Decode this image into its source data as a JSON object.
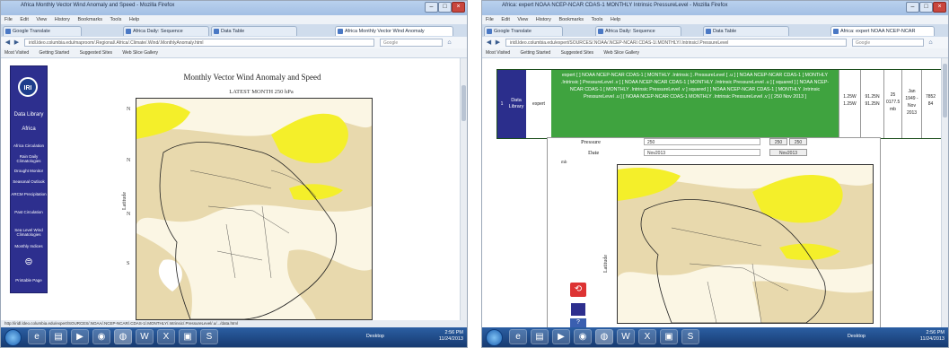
{
  "left_window": {
    "title": "Africa Monthly Vector Wind Anomaly and Speed - Mozilla Firefox",
    "menu": [
      "File",
      "Edit",
      "View",
      "History",
      "Bookmarks",
      "Tools",
      "Help"
    ],
    "tabs": [
      "Google Translate",
      "Africa Daily: Sequence",
      "Data Table",
      "Africa Monthly Vector Wind Anomaly"
    ],
    "url": "iridl.ldeo.columbia.edu/maproom/.Regional/.Africa/.Climate/.Wind/.MonthlyAnomaly.html",
    "search_placeholder": "Google",
    "bookmarks": [
      "Most Visited",
      "Getting Started",
      "Suggested Sites",
      "Web Slice Gallery"
    ],
    "sidebar": {
      "logo": "IRI",
      "items": [
        "Data Library",
        "Africa",
        "Africa Circulation",
        "Rain Daily Climatologies",
        "Drought Monitor",
        "Seasonal Outlook",
        "ARCM Precipitation",
        "Past Circulation",
        "Sea Level Wind Climatologies",
        "Monthly Indices",
        "Expert Mode",
        "Printable Page"
      ]
    },
    "page_title": "Monthly Vector Wind Anomaly and Speed",
    "subtitle": "LATEST MONTH 250 hPa",
    "status_text": "http://iridl.ldeo.columbia.edu/expert/SOURCES/.NOAA/.NCEP-NCAR/.CDAS-1/.MONTHLY/.Intrinsic/.PressureLevel/.u/.../data.html",
    "y_axis_label": "Latitude",
    "tray_time": "2:56 PM",
    "tray_date": "11/24/2013",
    "tray_lang": "Desktop"
  },
  "right_window": {
    "title": "Africa: expert NOAA NCEP-NCAR CDAS-1 MONTHLY Intrinsic PressureLevel - Mozilla Firefox",
    "menu": [
      "File",
      "Edit",
      "View",
      "History",
      "Bookmarks",
      "Tools",
      "Help"
    ],
    "tabs": [
      "Google Translate",
      "Africa Daily: Sequence",
      "Data Table",
      "Africa: expert NOAA NCEP-NCAR"
    ],
    "url": "iridl.ldeo.columbia.edu/expert/SOURCES/.NOAA/.NCEP-NCAR/.CDAS-1/.MONTHLY/.Intrinsic/.PressureLevel",
    "search_placeholder": "Google",
    "bookmarks": [
      "Most Visited",
      "Getting Started",
      "Suggested Sites",
      "Web Slice Gallery"
    ],
    "table": {
      "row_num": "1",
      "library": "Data Library",
      "dataset": "expert",
      "expression": "expert [ ] NOAA NCEP-NCAR CDAS-1 [ MONTHLY .Intrinsic ] .PressureLevel [ .u ] [ NOAA NCEP-NCAR CDAS-1 [ MONTHLY .Intrinsic ] PressureLevel .v ] [ NOAA NCEP-NCAR CDAS-1 [ MONTHLY .Intrinsic PressureLevel .u ] [ squared ] [ NOAA NCEP-NCAR CDAS-1 [ MONTHLY .Intrinsic PressureLevel .v ] squared ] [ NOAA NCEP-NCAR CDAS-1 [ MONTHLY .Intrinsic PressureLevel .u ] [ NOAA NCEP-NCAR CDAS-1 MONTHLY .Intrinsic PressureLevel .v ] [ 250 Nov 2013 ]",
      "lon": [
        "1.25W",
        "1.25W"
      ],
      "lat": [
        "91.25N",
        "91.25N"
      ],
      "level": "25 0177.5 mb",
      "time": "Jan 1949 - Nov 2013",
      "extra": "7852 84"
    },
    "form": {
      "pressure_label": "Pressure",
      "pressure_value": "250",
      "pressure_btn": "250",
      "date_label": "Date",
      "date_value": "Nov2013",
      "date_btn": "Nov2013",
      "side_label": "mb"
    },
    "y_axis_label": "Latitude",
    "tray_time": "2:56 PM",
    "tray_date": "11/24/2013",
    "tray_lang": "Desktop"
  },
  "colors": {
    "sidebar": "#2d2f8e",
    "table_green": "#3fa33f",
    "map_tan": "#e8d9ad",
    "map_yellow": "#f4ef2a",
    "taskbar": "#1f4c8c"
  }
}
